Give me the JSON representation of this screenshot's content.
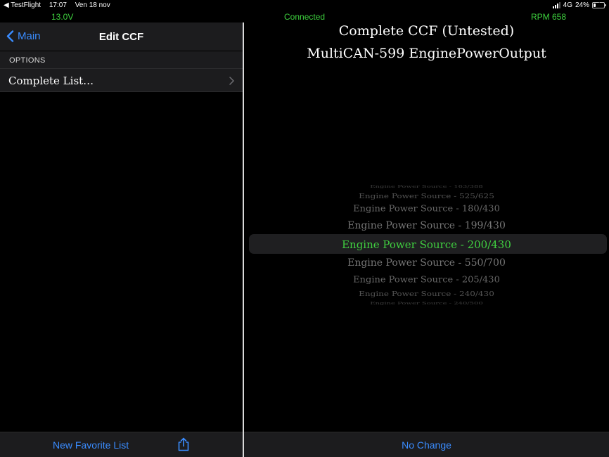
{
  "status_bar": {
    "back_app": "◀ TestFlight",
    "time": "17:07",
    "date": "Ven 18 nov",
    "network": "4G",
    "battery": "24%",
    "battery_level": 0.24
  },
  "telemetry": {
    "voltage": "13.0V",
    "connection": "Connected",
    "rpm": "RPM 658"
  },
  "left": {
    "back_label": "Main",
    "title": "Edit CCF",
    "section_header": "OPTIONS",
    "rows": [
      {
        "label": "Complete List…"
      }
    ],
    "toolbar": {
      "new_favorite_label": "New Favorite List"
    }
  },
  "right": {
    "title": "Complete CCF (Untested)",
    "subtitle": "MultiCAN-599 EnginePowerOutput",
    "picker": {
      "items": [
        "Engine Power Source - 163/388",
        "Engine Power Source - 525/625",
        "Engine Power Source - 180/430",
        "Engine Power Source - 199/430",
        "Engine Power Source - 200/430",
        "Engine Power Source - 550/700",
        "Engine Power Source - 205/430",
        "Engine Power Source - 240/430",
        "Engine Power Source - 240/500"
      ],
      "selected_index": 4
    },
    "toolbar": {
      "no_change_label": "No Change"
    }
  },
  "colors": {
    "accent": "#3a8cff",
    "status_green": "#3ed23e",
    "selected_green": "#40d040"
  }
}
